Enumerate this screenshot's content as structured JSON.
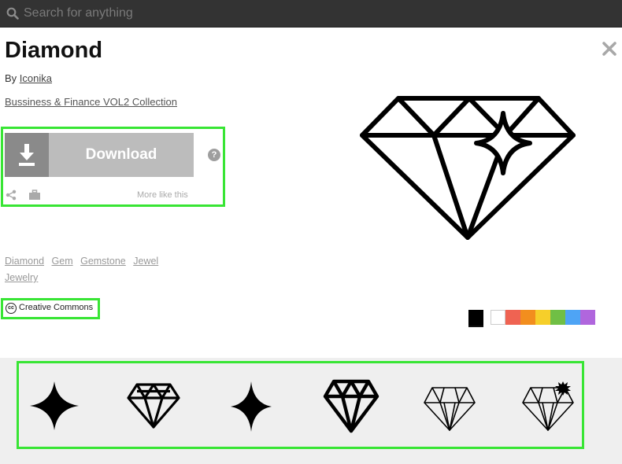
{
  "header": {
    "search_placeholder": "Search for anything"
  },
  "icon": {
    "title": "Diamond",
    "by_prefix": "By",
    "author": "Iconika",
    "collection": "Bussiness & Finance VOL2 Collection"
  },
  "actions": {
    "download_label": "Download",
    "help_glyph": "?",
    "more_like_label": "More like this"
  },
  "tags": [
    "Diamond",
    "Gem",
    "Gemstone",
    "Jewel",
    "Jewelry"
  ],
  "license": {
    "badge": "cc",
    "label": "Creative Commons"
  },
  "colors": {
    "swatches": [
      "#000000",
      "#ffffff",
      "#ef6352",
      "#f28e1e",
      "#f6cf2a",
      "#70bf45",
      "#4ea4f5",
      "#b066dd"
    ],
    "selected_index": 0,
    "highlight": "#38e534"
  },
  "related": [
    {
      "name": "sparkle-star-icon"
    },
    {
      "name": "diamond-outline-icon"
    },
    {
      "name": "sparkle-star-small-icon"
    },
    {
      "name": "diamond-bold-icon"
    },
    {
      "name": "diamond-thin-icon"
    },
    {
      "name": "diamond-shine-icon"
    }
  ]
}
